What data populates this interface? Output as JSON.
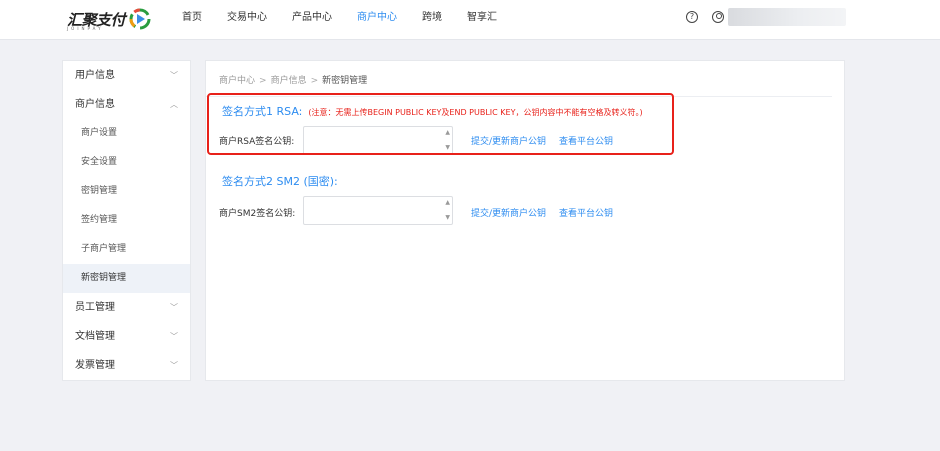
{
  "header": {
    "logo_text": "汇聚支付",
    "logo_sub": "JOINPAY",
    "nav": [
      {
        "label": "首页",
        "active": false
      },
      {
        "label": "交易中心",
        "active": false
      },
      {
        "label": "产品中心",
        "active": false
      },
      {
        "label": "商户中心",
        "active": true
      },
      {
        "label": "跨境",
        "active": false
      },
      {
        "label": "智享汇",
        "active": false
      }
    ],
    "help_icon": "?"
  },
  "sidebar": {
    "groups": [
      {
        "label": "用户信息",
        "chevron": "﹀"
      },
      {
        "label": "商户信息",
        "chevron": "︿"
      },
      {
        "label": "员工管理",
        "chevron": "﹀"
      },
      {
        "label": "文档管理",
        "chevron": "﹀"
      },
      {
        "label": "发票管理",
        "chevron": "﹀"
      }
    ],
    "sub_items": [
      "商户设置",
      "安全设置",
      "密钥管理",
      "签约管理",
      "子商户管理",
      "新密钥管理"
    ]
  },
  "main": {
    "breadcrumb": [
      "商户中心",
      "商户信息",
      "新密钥管理"
    ],
    "rsa": {
      "title": "签名方式1 RSA:",
      "note": "(注意：无需上传BEGIN PUBLIC KEY及END PUBLIC KEY，公钥内容中不能有空格及转义符。)",
      "label": "商户RSA签名公钥:",
      "submit_link": "提交/更新商户公钥",
      "view_link": "查看平台公钥"
    },
    "sm2": {
      "title": "签名方式2 SM2 (国密):",
      "label": "商户SM2签名公钥:",
      "submit_link": "提交/更新商户公钥",
      "view_link": "查看平台公钥"
    }
  },
  "colors": {
    "accent": "#2d8cf0",
    "warning": "#e8211a"
  }
}
